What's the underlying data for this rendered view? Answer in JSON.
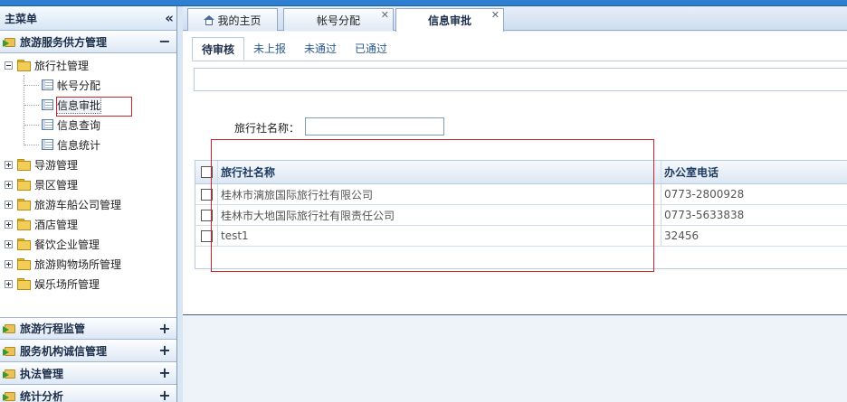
{
  "sidebar": {
    "title": "主菜单",
    "sections": [
      {
        "label": "旅游服务供方管理",
        "toggle": "−"
      },
      {
        "label": "旅游行程监管",
        "toggle": "+"
      },
      {
        "label": "服务机构诚信管理",
        "toggle": "+"
      },
      {
        "label": "执法管理",
        "toggle": "+"
      },
      {
        "label": "统计分析",
        "toggle": "+"
      }
    ],
    "tree": {
      "travel_agency": {
        "label": "旅行社管理",
        "children": [
          "帐号分配",
          "信息审批",
          "信息查询",
          "信息统计"
        ]
      },
      "others": [
        "导游管理",
        "景区管理",
        "旅游车船公司管理",
        "酒店管理",
        "餐饮企业管理",
        "旅游购物场所管理",
        "娱乐场所管理"
      ]
    }
  },
  "tabs": {
    "home": "我的主页",
    "account": "帐号分配",
    "approval": "信息审批"
  },
  "subtabs": [
    "待审核",
    "未上报",
    "未通过",
    "已通过"
  ],
  "search": {
    "label": "旅行社名称：",
    "value": ""
  },
  "grid": {
    "headers": {
      "name": "旅行社名称",
      "phone": "办公室电话"
    },
    "rows": [
      {
        "name": "桂林市漓旅国际旅行社有限公司",
        "phone": "0773-2800928"
      },
      {
        "name": "桂林市大地国际旅行社有限责任公司",
        "phone": "0773-5633838"
      },
      {
        "name": "test1",
        "phone": "32456"
      }
    ]
  },
  "colors": {
    "accent": "#2e7fd1",
    "annotation_red": "#d0242b"
  }
}
